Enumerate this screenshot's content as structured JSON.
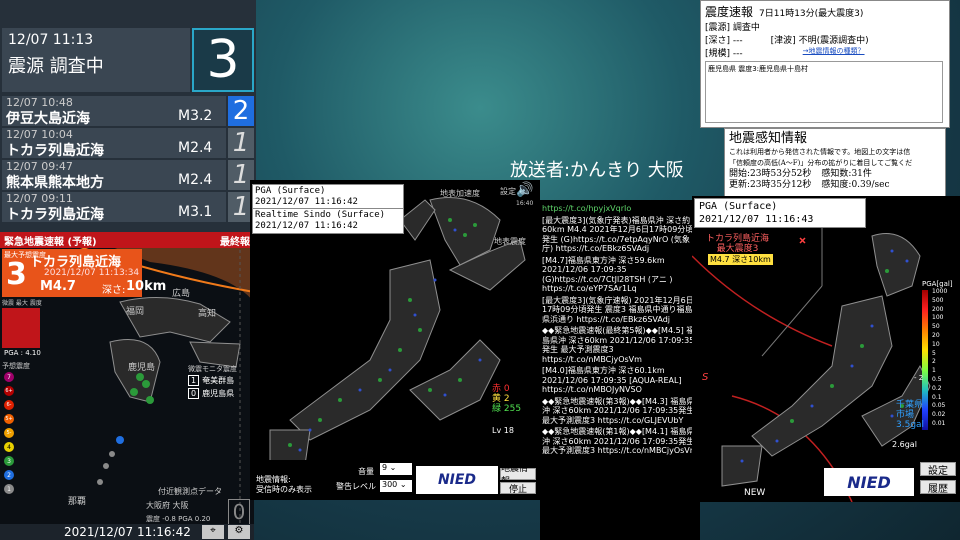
{
  "current": {
    "time": "12/07 11:13",
    "place": "震源 調査中",
    "intensity": "3"
  },
  "history": [
    {
      "time": "12/07 10:48",
      "place": "伊豆大島近海",
      "mag": "M3.2",
      "intensity": "2"
    },
    {
      "time": "12/07 10:04",
      "place": "トカラ列島近海",
      "mag": "M2.4",
      "intensity": "1"
    },
    {
      "time": "12/07 09:47",
      "place": "熊本県熊本地方",
      "mag": "M2.4",
      "intensity": "1"
    },
    {
      "time": "12/07 09:11",
      "place": "トカラ列島近海",
      "mag": "M3.1",
      "intensity": "1"
    }
  ],
  "eew": {
    "header": "緊急地震速報 (予報)",
    "final": "最終報",
    "max_label": "最大予想震度",
    "intensity": "3",
    "place": "トカラ列島近海",
    "datetime": "2021/12/07 11:13:34",
    "mag": "M4.7",
    "depth_label": "深さ:",
    "depth": "10km",
    "legend_title": "微震 最大 震度",
    "pga": "PGA : 4.10",
    "scale_label": "予想震度",
    "scale": [
      "7",
      "6+",
      "6-",
      "5+",
      "5-",
      "4",
      "3",
      "2",
      "1"
    ],
    "scale_colors": [
      "#a0006a",
      "#b40000",
      "#e02000",
      "#f06000",
      "#f0a000",
      "#e8d000",
      "#2b9a3a",
      "#1f6ee0",
      "#8a8a8a"
    ],
    "monitor_title": "微震モニタ震度",
    "monitor": [
      {
        "v": "1",
        "name": "奄美群島"
      },
      {
        "v": "0",
        "name": "鹿児島県"
      }
    ],
    "cities": [
      "広島",
      "福岡",
      "高知",
      "鹿児島",
      "那覇"
    ],
    "nearby_title": "付近観測点データ",
    "nearby_place": "大阪府 大阪",
    "nearby_value": "震度 -0.8  PGA 0.20",
    "nearby_intensity": "0",
    "clock": "2021/12/07 11:16:42"
  },
  "center": {
    "pga_label": "PGA (Surface)",
    "pga_time": "2021/12/07 11:16:42",
    "rt_label": "Realtime Sindo (Surface)",
    "rt_time": "2021/12/07 11:16:42",
    "accel_label": "地表加速度",
    "setting": "設定",
    "time_small": "16:40",
    "surface_label": "地表震度",
    "counts": {
      "red": "赤 0",
      "yellow": "黄 2",
      "green": "緑 255"
    },
    "lv": "Lv 18",
    "info_label": "地震情報:",
    "info_value": "受信時のみ表示",
    "volume_label": "音量",
    "volume_value": "9",
    "alert_label": "警告レベル",
    "alert_value": "300",
    "quake_btn": "地震情報",
    "stop_btn": "停止",
    "logo": "NIED"
  },
  "tweets": [
    "https://t.co/hpyjxVqrIo",
    "[最大震度3](気象庁発表)福島県沖 深さ約60km M4.4 2021年12月6日17時09分頃発生 (G)https://t.co/7etpAqyNrO (気象庁) https://t.co/EBkz6SVAdj",
    "[M4.7]福島県東方沖 深さ59.6km 2021/12/06 17:09:35 (G)https://t.co/7CtJl28TSH (アニ ) https://t.co/eYP7SAr1Lq",
    "[最大震度3](気象庁速報) 2021年12月6日17時09分頃発生 震度3 福島県中通り福島県浜通り https://t.co/EBkz6SVAdj",
    "◆◆緊急地震速報(最終第5報)◆◆[M4.5] 福島県沖 深さ60km 2021/12/06 17:09:35発生 最大予測震度3 https://t.co/nMBCjyOsVm",
    "[M4.0]福島県東方沖 深さ60.1km 2021/12/06 17:09:35 [AQUA-REAL] https://t.co/nMBOJyNVSO",
    "◆◆緊急地震速報(第3報)◆◆[M4.3] 福島県沖 深さ60km 2021/12/06 17:09:35発生 最大予測震度3 https://t.co/GLJEVUbY",
    "◆◆緊急地震速報(第1報)◆◆[M4.1] 福島県沖 深さ60km 2021/12/06 17:09:35発生 最大予測震度3 https://t.co/nMBCjyOsVm"
  ],
  "broadcaster": "放送者:かんきり 大阪",
  "sokuho": {
    "title": "震度速報",
    "sub": "7日11時13分(最大震度3)",
    "line1_label": "[震源]",
    "line1_value": "調査中",
    "line2_label": "[深さ]",
    "line2_value": "---",
    "line2b_label": "[津波]",
    "line2b_value": "不明(震源調査中)",
    "line3_label": "[規模]",
    "line3_value": "---",
    "link": "→地震情報の種類？",
    "area": "鹿児島県 震度3:鹿児島県十島村"
  },
  "kanchi": {
    "title": "地震感知情報",
    "desc1": "これは利用者から発信された情報です。地図上の文字は信",
    "desc2": "「信頼度の高低(A～F)」分布の拡がりに着目してご覧くだ",
    "start_label": "開始:",
    "start": "23時53分52秒",
    "count_label": "感知数:",
    "count": "31件",
    "update_label": "更新:",
    "update": "23時35分12秒",
    "rate_label": "感知度:",
    "rate": "0.39/sec"
  },
  "right": {
    "pga_label": "PGA (Surface)",
    "pga_time": "2021/12/07 11:16:43",
    "epi_place": "トカラ列島近海",
    "epi_max": "最大震度3",
    "epi_mag": "M4.7 深さ10km",
    "scale_title": "PGA[gal]",
    "scale": [
      "1000",
      "500",
      "200",
      "100",
      "50",
      "20",
      "10",
      "5",
      "2",
      "1",
      "0.5",
      "0.2",
      "0.1",
      "0.05",
      "0.02",
      "0.01"
    ],
    "marker": "- 2",
    "region": "千葉県",
    "region2": "市場",
    "region_val": "3.5gal",
    "max_val": "2.6gal",
    "new": "NEW",
    "logo": "NIED",
    "s_label": "S",
    "setting_btn": "設定",
    "history_btn": "履歴"
  }
}
